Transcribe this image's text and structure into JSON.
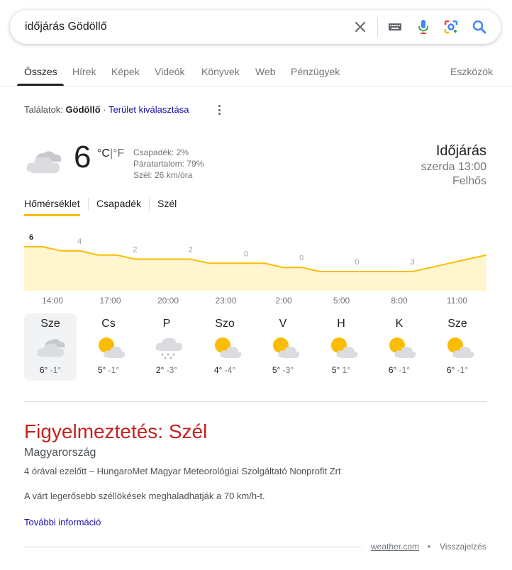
{
  "search": {
    "query": "időjárás Gödöllő",
    "icons": [
      "close-icon",
      "keyboard-icon",
      "microphone-icon",
      "lens-icon",
      "search-icon"
    ]
  },
  "tabs": {
    "items": [
      "Összes",
      "Hírek",
      "Képek",
      "Videók",
      "Könyvek",
      "Web",
      "Pénzügyek"
    ],
    "active": "Összes",
    "tools": "Eszközök"
  },
  "results_for": {
    "prefix": "Találatok:",
    "location": "Gödöllő",
    "separator": "·",
    "change_link": "Terület kiválasztása"
  },
  "weather": {
    "temp": "6",
    "unit_c": "°C",
    "unit_sep": "|",
    "unit_f": "°F",
    "precip": "Csapadék: 2%",
    "humidity": "Páratartalom: 79%",
    "wind": "Szél: 26 km/óra",
    "title": "Időjárás",
    "time": "szerda 13:00",
    "condition": "Felhős",
    "icon": "cloudy-icon"
  },
  "chart_tabs": {
    "items": [
      "Hőmérséklet",
      "Csapadék",
      "Szél"
    ],
    "active": "Hőmérséklet"
  },
  "chart_data": {
    "type": "area",
    "x": [
      "14:00",
      "17:00",
      "20:00",
      "23:00",
      "2:00",
      "5:00",
      "8:00",
      "11:00"
    ],
    "hourly": [
      6,
      6,
      5,
      5,
      4,
      4,
      3,
      3,
      3,
      3,
      2,
      2,
      2,
      2,
      1,
      1,
      0,
      0,
      0,
      0,
      0,
      0,
      1,
      2,
      3,
      4
    ],
    "labels": [
      {
        "hour_index": 0,
        "value": "6"
      },
      {
        "hour_index": 3,
        "value": "4"
      },
      {
        "hour_index": 6,
        "value": "2"
      },
      {
        "hour_index": 9,
        "value": "2"
      },
      {
        "hour_index": 12,
        "value": "0"
      },
      {
        "hour_index": 15,
        "value": "0"
      },
      {
        "hour_index": 18,
        "value": "0"
      },
      {
        "hour_index": 21,
        "value": "3"
      }
    ],
    "colors": {
      "line": "#fbbc04",
      "fill": "#fff5ce"
    }
  },
  "forecast": [
    {
      "day": "Sze",
      "hi": "6°",
      "lo": "-1°",
      "icon": "cloudy-icon"
    },
    {
      "day": "Cs",
      "hi": "5°",
      "lo": "-1°",
      "icon": "partly-sunny-icon"
    },
    {
      "day": "P",
      "hi": "2°",
      "lo": "-3°",
      "icon": "snow-icon"
    },
    {
      "day": "Szo",
      "hi": "4°",
      "lo": "-4°",
      "icon": "partly-sunny-icon"
    },
    {
      "day": "V",
      "hi": "5°",
      "lo": "-3°",
      "icon": "partly-sunny-icon"
    },
    {
      "day": "H",
      "hi": "5°",
      "lo": "1°",
      "icon": "partly-sunny-icon"
    },
    {
      "day": "K",
      "hi": "6°",
      "lo": "-1°",
      "icon": "partly-sunny-icon"
    },
    {
      "day": "Sze",
      "hi": "6°",
      "lo": "-1°",
      "icon": "partly-sunny-icon"
    }
  ],
  "warning": {
    "title": "Figyelmeztetés: Szél",
    "region": "Magyarország",
    "meta": "4 órával ezelőtt – HungaroMet Magyar Meteorológiai Szolgáltató Nonprofit Zrt",
    "body": "A várt legerősebb széllökések meghaladhatják a 70 km/h-t.",
    "more": "További információ"
  },
  "footer": {
    "source": "weather.com",
    "dot": "•",
    "feedback": "Visszajelzés"
  },
  "colors": {
    "accent_yellow": "#fbbc04",
    "warning_red": "#c5221f",
    "link_blue": "#1a0dab"
  }
}
